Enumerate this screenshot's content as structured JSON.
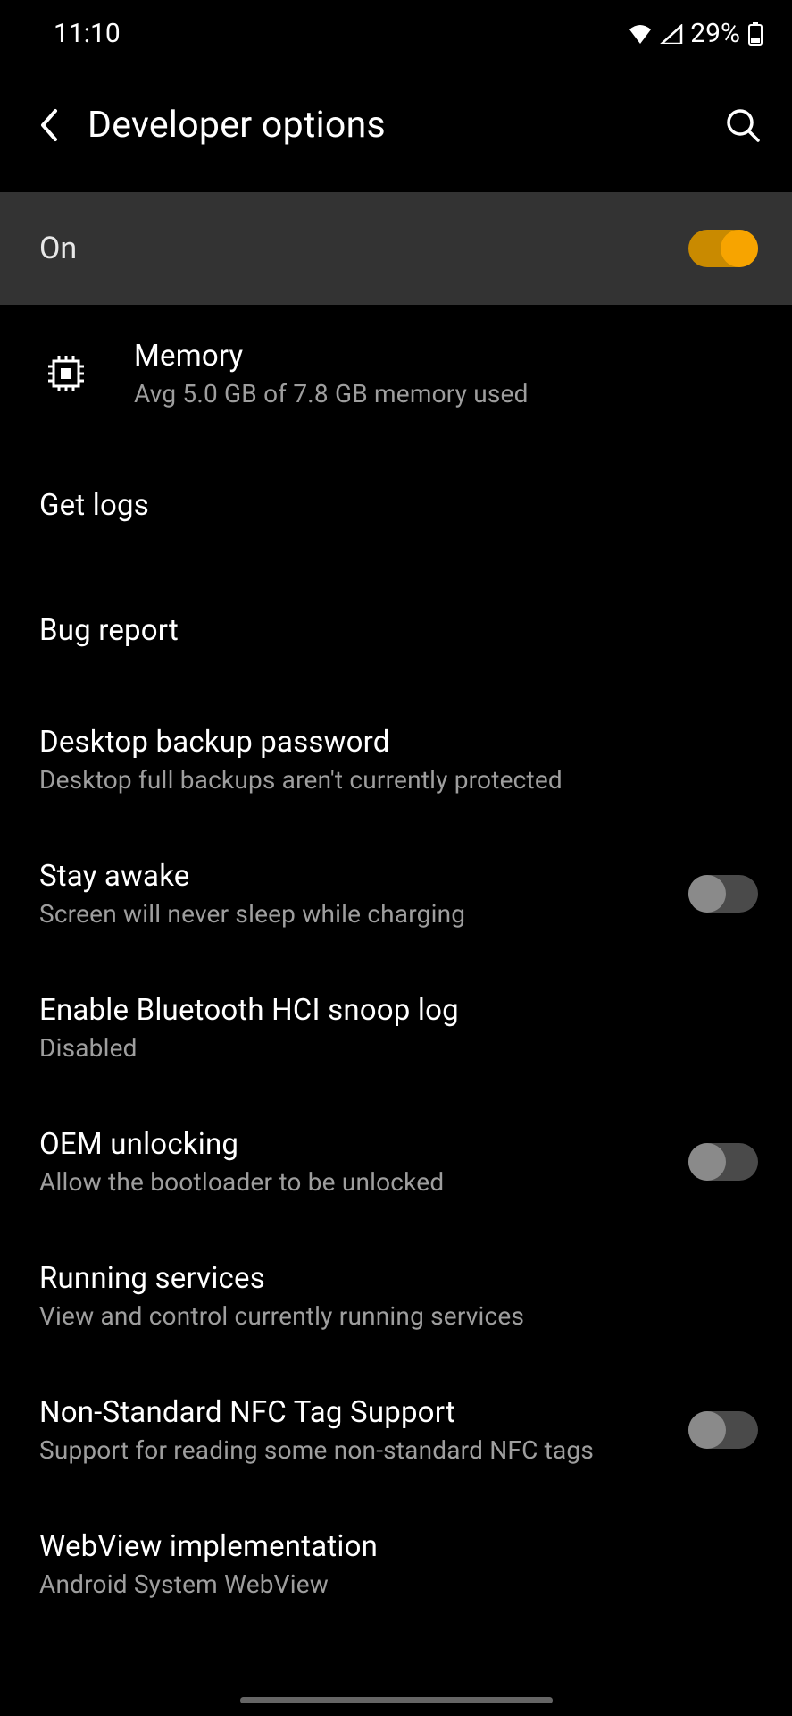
{
  "status": {
    "time": "11:10",
    "battery": "29%"
  },
  "header": {
    "title": "Developer options"
  },
  "masterToggle": {
    "label": "On",
    "enabled": true
  },
  "settings": [
    {
      "id": "memory",
      "title": "Memory",
      "subtitle": "Avg 5.0 GB of 7.8 GB memory used",
      "hasIcon": true,
      "hasToggle": false
    },
    {
      "id": "get-logs",
      "title": "Get logs",
      "subtitle": null,
      "hasIcon": false,
      "hasToggle": false
    },
    {
      "id": "bug-report",
      "title": "Bug report",
      "subtitle": null,
      "hasIcon": false,
      "hasToggle": false
    },
    {
      "id": "desktop-backup",
      "title": "Desktop backup password",
      "subtitle": "Desktop full backups aren't currently protected",
      "hasIcon": false,
      "hasToggle": false
    },
    {
      "id": "stay-awake",
      "title": "Stay awake",
      "subtitle": "Screen will never sleep while charging",
      "hasIcon": false,
      "hasToggle": true,
      "toggleOn": false
    },
    {
      "id": "bluetooth-hci",
      "title": "Enable Bluetooth HCI snoop log",
      "subtitle": "Disabled",
      "hasIcon": false,
      "hasToggle": false
    },
    {
      "id": "oem-unlocking",
      "title": "OEM unlocking",
      "subtitle": "Allow the bootloader to be unlocked",
      "hasIcon": false,
      "hasToggle": true,
      "toggleOn": false
    },
    {
      "id": "running-services",
      "title": "Running services",
      "subtitle": "View and control currently running services",
      "hasIcon": false,
      "hasToggle": false
    },
    {
      "id": "nfc-tag",
      "title": "Non-Standard NFC Tag Support",
      "subtitle": "Support for reading some non-standard NFC tags",
      "hasIcon": false,
      "hasToggle": true,
      "toggleOn": false
    },
    {
      "id": "webview",
      "title": "WebView implementation",
      "subtitle": "Android System WebView",
      "hasIcon": false,
      "hasToggle": false
    }
  ]
}
